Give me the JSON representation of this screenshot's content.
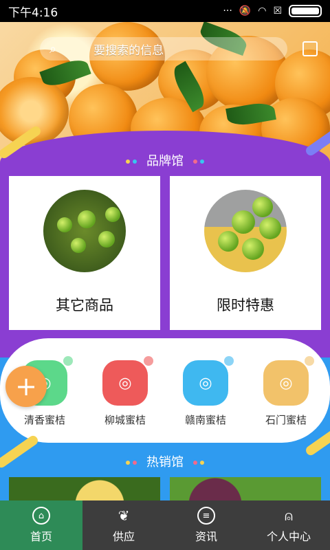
{
  "status": {
    "time": "下午4:16"
  },
  "search": {
    "placeholder": "要搜索的信息"
  },
  "brand_section": {
    "title": "品牌馆"
  },
  "cards": [
    {
      "label": "其它商品"
    },
    {
      "label": "限时特惠"
    }
  ],
  "categories": [
    {
      "label": "清香蜜桔",
      "color": "#5cd88a"
    },
    {
      "label": "柳城蜜桔",
      "color": "#ee5a5a"
    },
    {
      "label": "赣南蜜桔",
      "color": "#3fb8f0"
    },
    {
      "label": "石门蜜桔",
      "color": "#f2c26a"
    }
  ],
  "hot_section": {
    "title": "热销馆"
  },
  "tabs": [
    {
      "label": "首页",
      "icon": "home-icon"
    },
    {
      "label": "供应",
      "icon": "plant-icon"
    },
    {
      "label": "资讯",
      "icon": "news-icon"
    },
    {
      "label": "个人中心",
      "icon": "user-icon"
    }
  ],
  "colors": {
    "purple": "#8a3ed2",
    "blue": "#2f9bf0",
    "active_tab": "#2e8b57",
    "tabbar": "#3d3d3d",
    "fab": "#f7a14b"
  }
}
